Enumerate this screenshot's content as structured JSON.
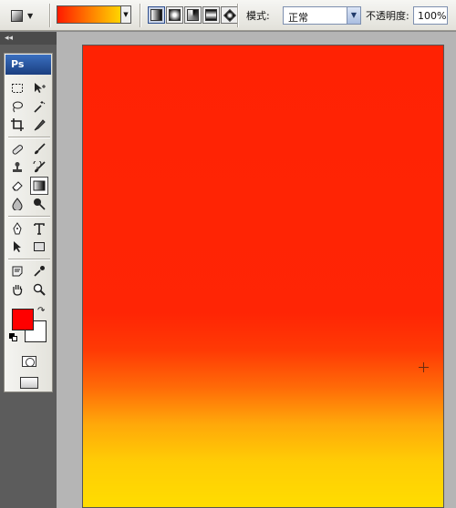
{
  "options_bar": {
    "tool_preset_icon": "gradient-tool-icon",
    "gradient_colors": [
      "#ff1a00",
      "#ff7a00",
      "#ffd400"
    ],
    "gradient_types": [
      "linear",
      "radial",
      "angle",
      "reflected",
      "diamond"
    ],
    "active_gradient_type": "linear",
    "mode_label": "模式:",
    "mode_value": "正常",
    "opacity_label": "不透明度:",
    "opacity_value": "100%"
  },
  "toolbox": {
    "logo": "Ps",
    "tools": [
      "marquee-icon",
      "move-icon",
      "lasso-icon",
      "magic-wand-icon",
      "crop-icon",
      "slice-icon",
      "healing-brush-icon",
      "brush-icon",
      "clone-stamp-icon",
      "history-brush-icon",
      "eraser-icon",
      "gradient-icon",
      "blur-icon",
      "dodge-icon",
      "pen-icon",
      "type-icon",
      "path-selection-icon",
      "shape-icon",
      "notes-icon",
      "eyedropper-icon",
      "hand-icon",
      "zoom-icon"
    ],
    "active_tool": "gradient-icon",
    "foreground_color": "#ff0000",
    "background_color": "#ffffff"
  },
  "canvas": {
    "gradient_stops": [
      "#ff2203",
      "#ff2505",
      "#ff6a08",
      "#ffa80a",
      "#ffdd00"
    ]
  }
}
